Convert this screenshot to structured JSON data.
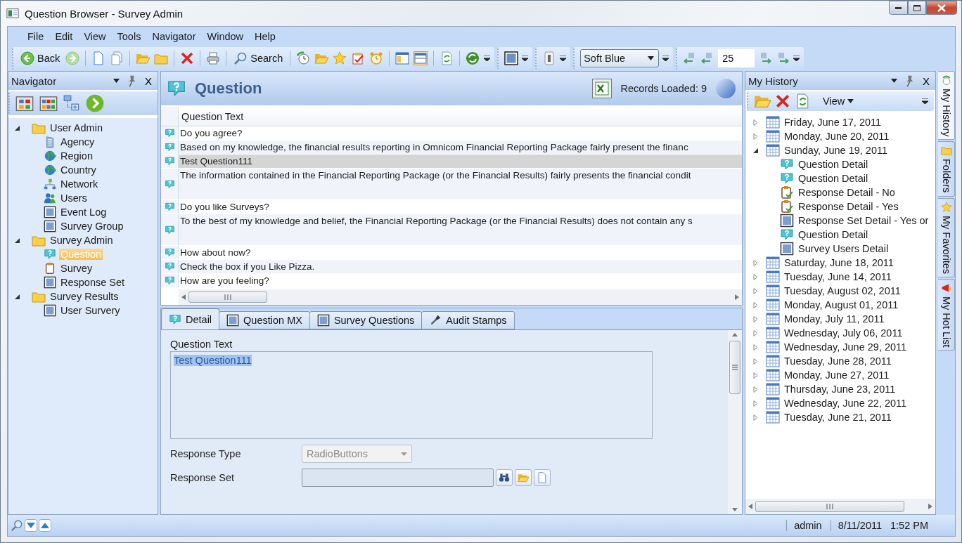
{
  "window": {
    "title": "Question Browser - Survey Admin"
  },
  "menu": [
    "File",
    "Edit",
    "View",
    "Tools",
    "Navigator",
    "Window",
    "Help"
  ],
  "toolbar": {
    "back": "Back",
    "search": "Search",
    "theme": "Soft Blue",
    "page_size": "25"
  },
  "navigator": {
    "title": "Navigator",
    "close": "X",
    "items": [
      {
        "label": "User Admin",
        "kind": "folder",
        "expanded": true,
        "selected": false,
        "children": [
          {
            "label": "Agency",
            "kind": "building",
            "selected": false
          },
          {
            "label": "Region",
            "kind": "globe",
            "selected": false
          },
          {
            "label": "Country",
            "kind": "globe",
            "selected": false
          },
          {
            "label": "Network",
            "kind": "network",
            "selected": false
          },
          {
            "label": "Users",
            "kind": "users",
            "selected": false
          },
          {
            "label": "Event Log",
            "kind": "form",
            "selected": false
          },
          {
            "label": "Survey Group",
            "kind": "form",
            "selected": false
          }
        ]
      },
      {
        "label": "Survey Admin",
        "kind": "folder",
        "expanded": true,
        "selected": false,
        "children": [
          {
            "label": "Question",
            "kind": "question",
            "selected": true
          },
          {
            "label": "Survey",
            "kind": "clipboard",
            "selected": false
          },
          {
            "label": "Response Set",
            "kind": "form",
            "selected": false
          }
        ]
      },
      {
        "label": "Survey Results",
        "kind": "folder",
        "expanded": true,
        "selected": false,
        "children": [
          {
            "label": "User Survery",
            "kind": "form",
            "selected": false
          }
        ]
      }
    ]
  },
  "question_panel": {
    "title": "Question",
    "records": "Records Loaded: 9",
    "grid": {
      "column": "Question Text",
      "rows": [
        {
          "text": "Do you agree?",
          "selected": false,
          "tall": false
        },
        {
          "text": "Based on my knowledge, the financial results reporting in Omnicom Financial Reporting Package fairly present the financ",
          "selected": false,
          "tall": false
        },
        {
          "text": "Test Question111",
          "selected": true,
          "tall": false
        },
        {
          "text": "The information contained in the Financial Reporting Package (or the Financial Results) fairly presents the financial condit",
          "selected": false,
          "tall": true
        },
        {
          "text": "Do you like Surveys?",
          "selected": false,
          "tall": false
        },
        {
          "text": "To the best of my knowledge and belief, the Financial Reporting Package (or the Financial Results) does not contain any s",
          "selected": false,
          "tall": true
        },
        {
          "text": "How about now?",
          "selected": false,
          "tall": false
        },
        {
          "text": "Check the box if you Like Pizza.",
          "selected": false,
          "tall": false
        },
        {
          "text": "How are you feeling?",
          "selected": false,
          "tall": false
        }
      ]
    },
    "tabs": [
      {
        "label": "Detail",
        "kind": "question",
        "selected": true
      },
      {
        "label": "Question MX",
        "kind": "form",
        "selected": false
      },
      {
        "label": "Survey Questions",
        "kind": "form",
        "selected": false
      },
      {
        "label": "Audit Stamps",
        "kind": "stamp",
        "selected": false
      }
    ],
    "form": {
      "question_label": "Question Text",
      "question_value": "Test Question111",
      "type_label": "Response Type",
      "type_value": "RadioButtons",
      "type_disabled": true,
      "set_label": "Response Set"
    }
  },
  "history": {
    "title": "My History",
    "close": "X",
    "view": "View",
    "items": [
      {
        "label": "Friday, June 17, 2011",
        "expanded": false
      },
      {
        "label": "Monday, June 20, 2011",
        "expanded": false
      },
      {
        "label": "Sunday, June 19, 2011",
        "expanded": true,
        "children": [
          {
            "label": "Question Detail",
            "kind": "question"
          },
          {
            "label": "Question Detail",
            "kind": "question"
          },
          {
            "label": "Response Detail - No",
            "kind": "response"
          },
          {
            "label": "Response Detail - Yes",
            "kind": "response"
          },
          {
            "label": "Response Set Detail - Yes or",
            "kind": "form"
          },
          {
            "label": "Question Detail",
            "kind": "question"
          },
          {
            "label": "Survey Users Detail",
            "kind": "form"
          }
        ]
      },
      {
        "label": "Saturday, June 18, 2011",
        "expanded": false
      },
      {
        "label": "Tuesday, June 14, 2011",
        "expanded": false
      },
      {
        "label": "Tuesday, August 02, 2011",
        "expanded": false
      },
      {
        "label": "Monday, August 01, 2011",
        "expanded": false
      },
      {
        "label": "Monday, July 11, 2011",
        "expanded": false
      },
      {
        "label": "Wednesday, July 06, 2011",
        "expanded": false
      },
      {
        "label": "Wednesday, June 29, 2011",
        "expanded": false
      },
      {
        "label": "Tuesday, June 28, 2011",
        "expanded": false
      },
      {
        "label": "Monday, June 27, 2011",
        "expanded": false
      },
      {
        "label": "Thursday, June 23, 2011",
        "expanded": false
      },
      {
        "label": "Wednesday, June 22, 2011",
        "expanded": false
      },
      {
        "label": "Tuesday, June 21, 2011",
        "expanded": false
      }
    ]
  },
  "side_tabs": [
    {
      "label": "My History",
      "kind": "history",
      "selected": true
    },
    {
      "label": "Folders",
      "kind": "folder",
      "selected": false
    },
    {
      "label": "My Favorites",
      "kind": "star",
      "selected": false
    },
    {
      "label": "My Hot List",
      "kind": "hot",
      "selected": false
    }
  ],
  "status_bar": {
    "user": "admin",
    "date": "8/11/2011",
    "time": "1:52 PM"
  }
}
